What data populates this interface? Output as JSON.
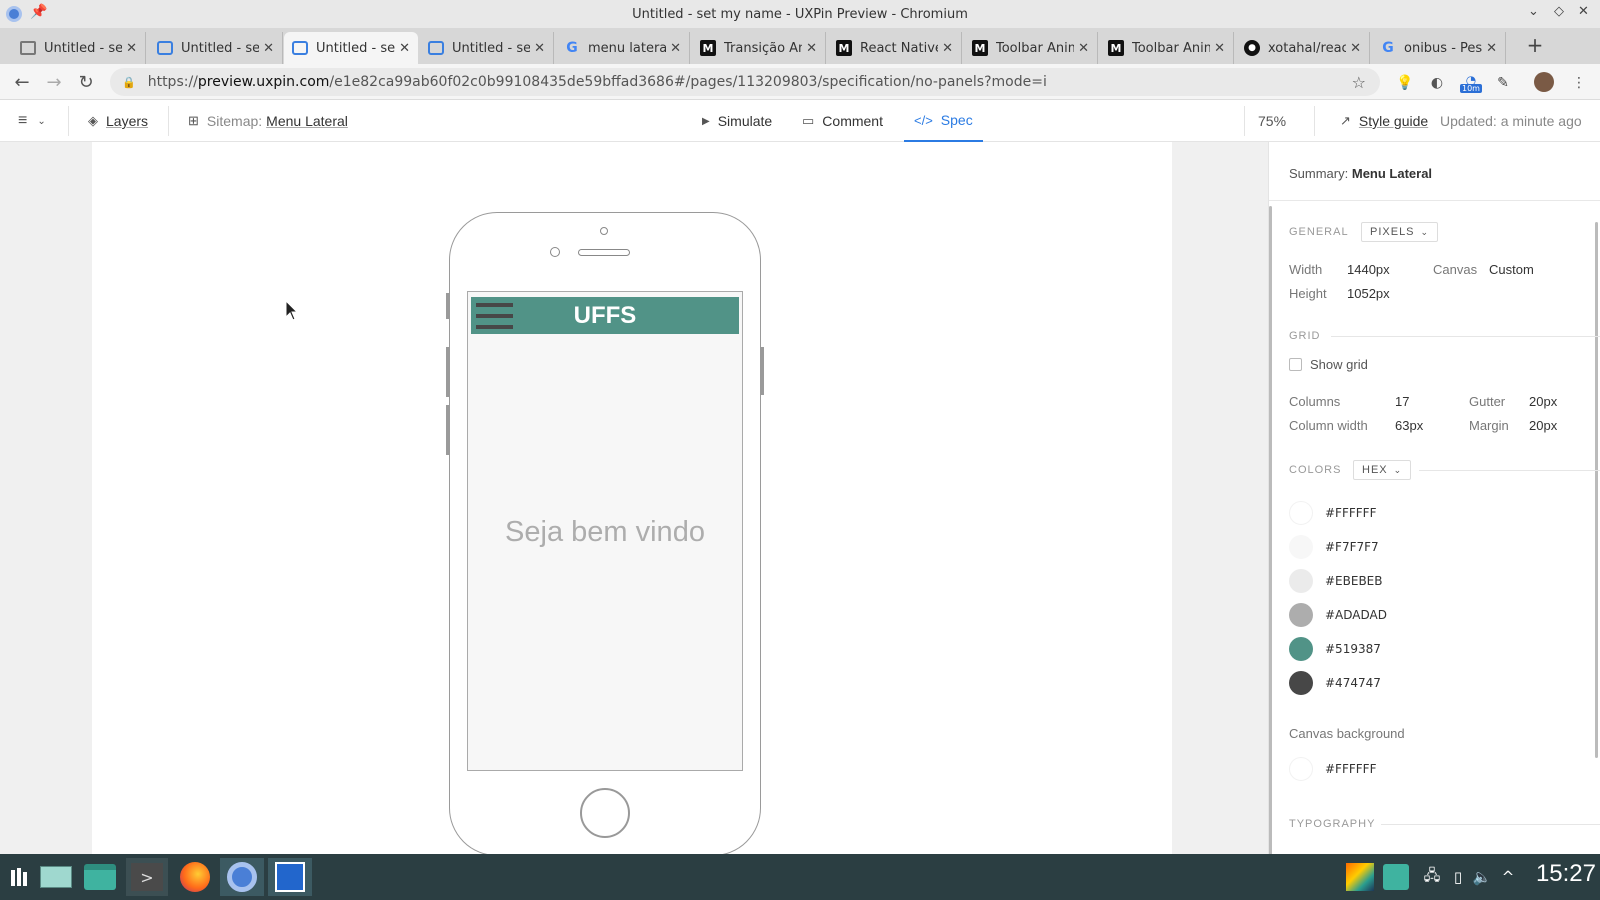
{
  "window": {
    "title": "Untitled - set my name - UXPin Preview - Chromium"
  },
  "tabs": [
    {
      "label": "Untitled - set my name",
      "favicon": "page-icon",
      "active": false
    },
    {
      "label": "Untitled - set my name",
      "favicon": "uxpin-icon",
      "active": false
    },
    {
      "label": "Untitled - set my name",
      "favicon": "uxpin-icon",
      "active": true
    },
    {
      "label": "Untitled - set my name",
      "favicon": "uxpin-icon",
      "active": false
    },
    {
      "label": "menu lateral",
      "favicon": "google-icon",
      "active": false
    },
    {
      "label": "Transição Animada",
      "favicon": "medium-icon",
      "active": false
    },
    {
      "label": "React Native",
      "favicon": "medium-icon",
      "active": false
    },
    {
      "label": "Toolbar Animada",
      "favicon": "medium-icon",
      "active": false
    },
    {
      "label": "Toolbar Animada",
      "favicon": "medium-icon",
      "active": false
    },
    {
      "label": "xotahal/react",
      "favicon": "github-icon",
      "active": false
    },
    {
      "label": "onibus - Pesquisa",
      "favicon": "google-icon",
      "active": false
    }
  ],
  "address": {
    "protocol": "https://",
    "domain": "preview.uxpin.com",
    "path": "/e1e82ca99ab60f02c0b99108435de59bffad3686#/pages/113209803/specification/no-panels?mode=i"
  },
  "extensions": {
    "badge": "10m"
  },
  "uxpin_toolbar": {
    "layers_label": "Layers",
    "sitemap_prefix": "Sitemap:",
    "sitemap_page": "Menu Lateral",
    "simulate_label": "Simulate",
    "comment_label": "Comment",
    "spec_label": "Spec",
    "zoom": "75%",
    "style_guide_label": "Style guide",
    "updated_text": "Updated: a minute ago"
  },
  "prototype": {
    "app_title": "UFFS",
    "welcome_text": "Seja bem vindo",
    "appbar_color": "#519387",
    "icon_color": "#474747",
    "text_color": "#ADADAD"
  },
  "spec": {
    "summary_prefix": "Summary:",
    "summary_name": "Menu Lateral",
    "general": {
      "section_label": "GENERAL",
      "unit_select": "PIXELS",
      "width_label": "Width",
      "width_value": "1440px",
      "height_label": "Height",
      "height_value": "1052px",
      "canvas_label": "Canvas",
      "canvas_value": "Custom"
    },
    "grid": {
      "section_label": "GRID",
      "show_grid_label": "Show grid",
      "columns_label": "Columns",
      "columns_value": "17",
      "gutter_label": "Gutter",
      "gutter_value": "20px",
      "column_width_label": "Column width",
      "column_width_value": "63px",
      "margin_label": "Margin",
      "margin_value": "20px"
    },
    "colors": {
      "section_label": "COLORS",
      "format_select": "HEX",
      "swatches": [
        "#FFFFFF",
        "#F7F7F7",
        "#EBEBEB",
        "#ADADAD",
        "#519387",
        "#474747"
      ]
    },
    "canvas_background": {
      "label": "Canvas background",
      "value": "#FFFFFF"
    },
    "typography": {
      "section_label": "TYPOGRAPHY"
    }
  },
  "taskbar": {
    "clock": "15:27"
  }
}
